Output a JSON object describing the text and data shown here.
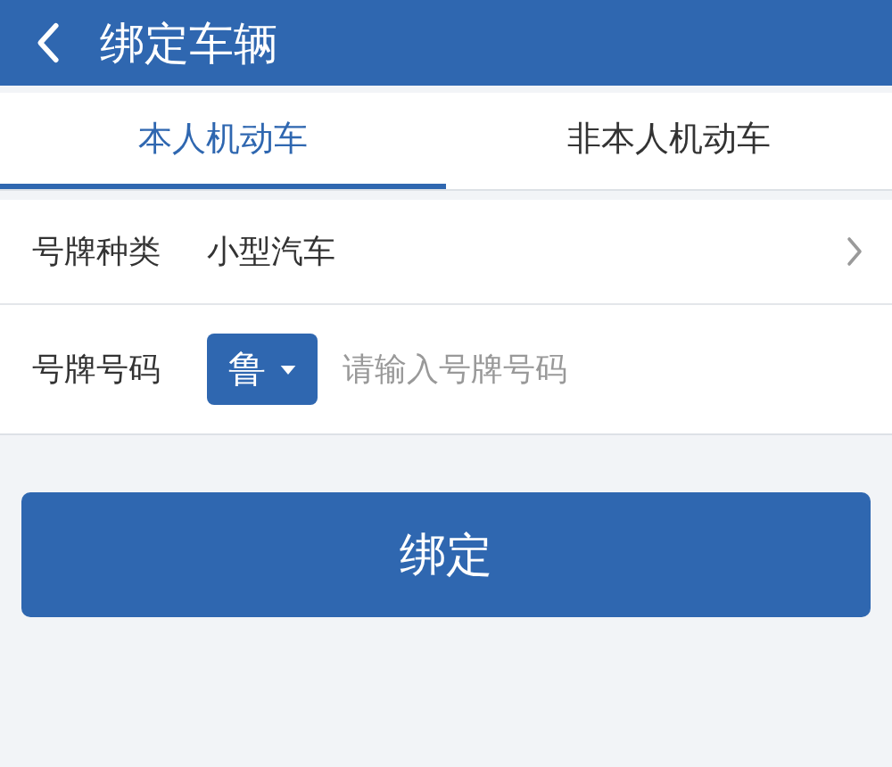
{
  "header": {
    "title": "绑定车辆"
  },
  "tabs": [
    {
      "label": "本人机动车",
      "selected": true
    },
    {
      "label": "非本人机动车",
      "selected": false
    }
  ],
  "form": [
    {
      "kind": "select",
      "label": "号牌种类",
      "value": "小型汽车"
    },
    {
      "kind": "plate",
      "label": "号牌号码",
      "prefix": "鲁",
      "placeholder": "请输入号牌号码"
    }
  ],
  "submit": "绑定"
}
